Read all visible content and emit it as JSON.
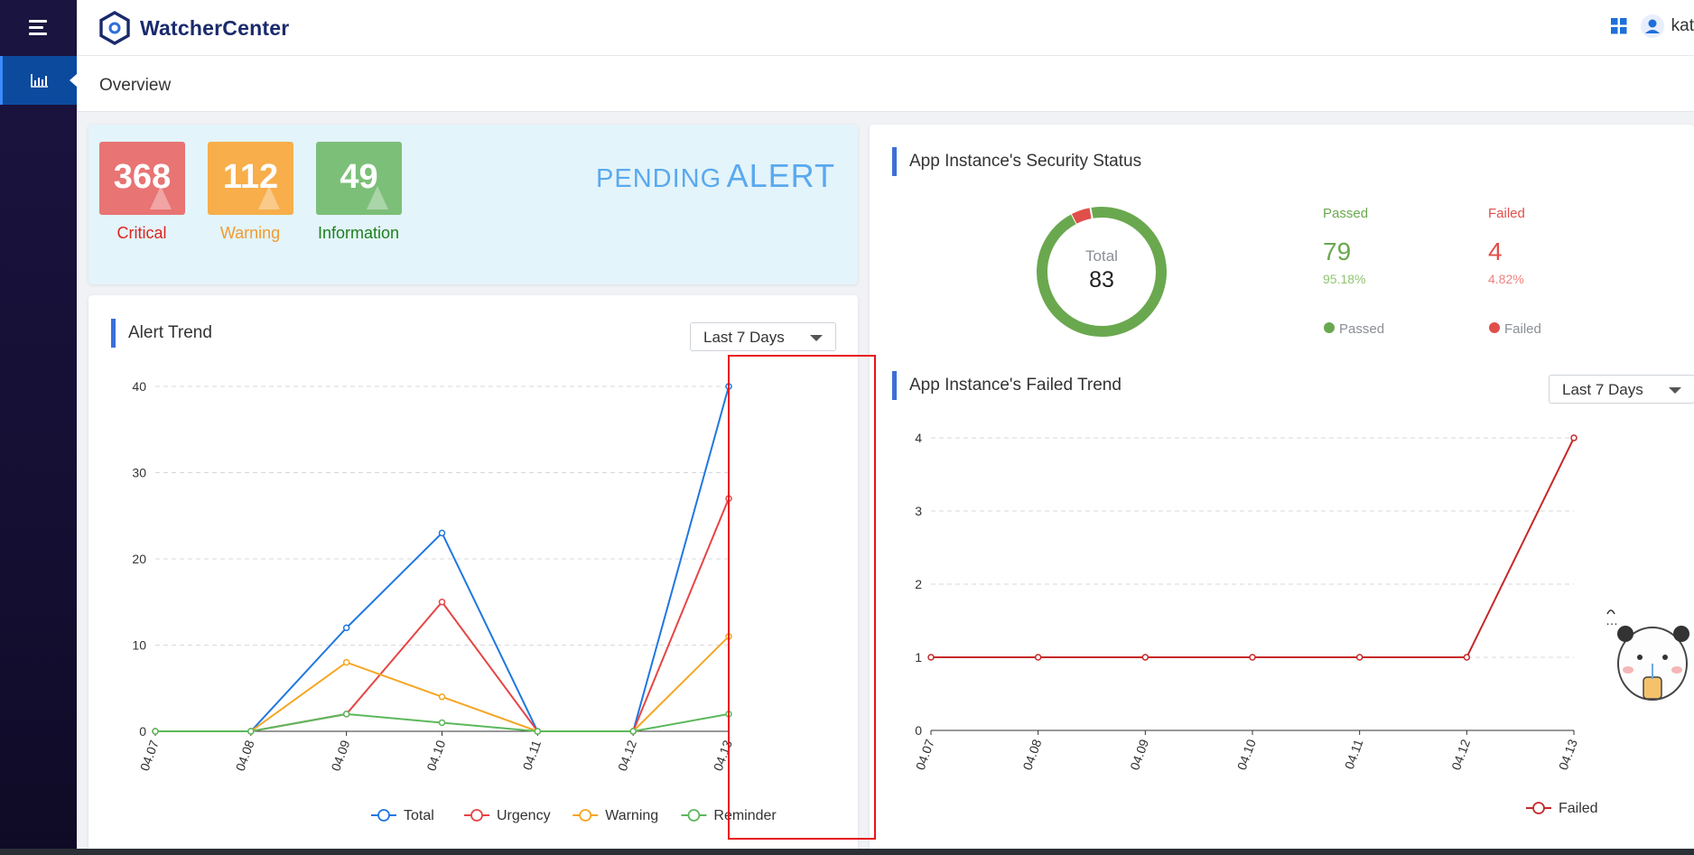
{
  "app": {
    "name": "WatcherCenter",
    "user": "kat"
  },
  "breadcrumb": {
    "title": "Overview"
  },
  "pending_alert": {
    "title_part1": "PENDING",
    "title_part2": "ALERT",
    "badges": [
      {
        "count": "368",
        "label": "Critical",
        "color": "#e87474",
        "label_color": "#e0231c"
      },
      {
        "count": "112",
        "label": "Warning",
        "color": "#f7ae4b",
        "label_color": "#f29a2e"
      },
      {
        "count": "49",
        "label": "Information",
        "color": "#7cbf79",
        "label_color": "#1d7f1b"
      }
    ]
  },
  "alert_trend": {
    "title": "Alert Trend",
    "range": "Last 7 Days"
  },
  "security_status": {
    "title": "App Instance's Security Status",
    "total_label": "Total",
    "total": "83",
    "passed_label": "Passed",
    "passed_count": "79",
    "passed_pct": "95.18%",
    "failed_label": "Failed",
    "failed_count": "4",
    "failed_pct": "4.82%",
    "legend_passed": "Passed",
    "legend_failed": "Failed",
    "colors": {
      "passed": "#6aa84f",
      "failed": "#e04f4a"
    }
  },
  "failed_trend": {
    "title": "App Instance's Failed Trend",
    "range": "Last 7 Days"
  },
  "chart_data": [
    {
      "type": "line",
      "x": [
        "04.07",
        "04.08",
        "04.09",
        "04.10",
        "04.11",
        "04.12",
        "04.13"
      ],
      "ylim": [
        0,
        40
      ],
      "yticks": [
        0,
        10,
        20,
        30,
        40
      ],
      "grid": true,
      "legend_position": "bottom",
      "series": [
        {
          "name": "Total",
          "color": "#1f77e0",
          "values": [
            0,
            0,
            12,
            23,
            0,
            0,
            40
          ]
        },
        {
          "name": "Urgency",
          "color": "#e64545",
          "values": [
            0,
            0,
            2,
            15,
            0,
            0,
            27
          ]
        },
        {
          "name": "Warning",
          "color": "#f5a623",
          "values": [
            0,
            0,
            8,
            4,
            0,
            0,
            11
          ]
        },
        {
          "name": "Reminder",
          "color": "#5cb85c",
          "values": [
            0,
            0,
            2,
            1,
            0,
            0,
            2
          ]
        }
      ]
    },
    {
      "type": "pie",
      "slices": [
        {
          "label": "Passed",
          "value": 79,
          "color": "#6aa84f"
        },
        {
          "label": "Failed",
          "value": 4,
          "color": "#e04f4a"
        }
      ]
    },
    {
      "type": "line",
      "x": [
        "04.07",
        "04.08",
        "04.09",
        "04.10",
        "04.11",
        "04.12",
        "04.13"
      ],
      "ylim": [
        0,
        4
      ],
      "yticks": [
        0,
        1,
        2,
        3,
        4
      ],
      "grid": true,
      "legend_position": "bottom",
      "series": [
        {
          "name": "Failed",
          "color": "#c62828",
          "values": [
            1,
            1,
            1,
            1,
            1,
            1,
            4
          ]
        }
      ]
    }
  ]
}
